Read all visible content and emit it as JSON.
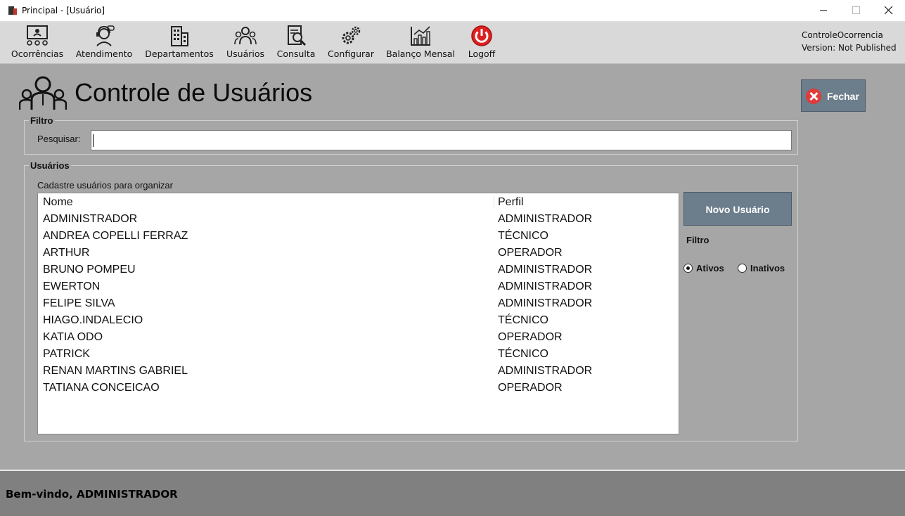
{
  "window": {
    "title": "Principal - [Usuário]"
  },
  "toolbar": {
    "items": [
      {
        "label": "Ocorrências",
        "icon": "dashboard-people-icon"
      },
      {
        "label": "Atendimento",
        "icon": "support-agent-icon"
      },
      {
        "label": "Departamentos",
        "icon": "building-icon"
      },
      {
        "label": "Usuários",
        "icon": "users-group-icon"
      },
      {
        "label": "Consulta",
        "icon": "document-search-icon"
      },
      {
        "label": "Configurar",
        "icon": "gears-icon"
      },
      {
        "label": "Balanço Mensal",
        "icon": "bar-chart-icon"
      },
      {
        "label": "Logoff",
        "icon": "power-icon"
      }
    ],
    "app_name": "ControleOcorrencia",
    "version": "Version: Not Published"
  },
  "page": {
    "title": "Controle de Usuários",
    "close_label": "Fechar"
  },
  "filter_group": {
    "title": "Filtro",
    "search_label": "Pesquisar:",
    "search_value": ""
  },
  "users_group": {
    "title": "Usuários",
    "hint": "Cadastre usuários para organizar",
    "columns": [
      "Nome",
      "Perfil"
    ],
    "rows": [
      {
        "nome": "ADMINISTRADOR",
        "perfil": "ADMINISTRADOR"
      },
      {
        "nome": "ANDREA COPELLI FERRAZ",
        "perfil": "TÉCNICO"
      },
      {
        "nome": "ARTHUR",
        "perfil": "OPERADOR"
      },
      {
        "nome": "BRUNO POMPEU",
        "perfil": "ADMINISTRADOR"
      },
      {
        "nome": "EWERTON",
        "perfil": "ADMINISTRADOR"
      },
      {
        "nome": "FELIPE SILVA",
        "perfil": "ADMINISTRADOR"
      },
      {
        "nome": "HIAGO.INDALECIO",
        "perfil": "TÉCNICO"
      },
      {
        "nome": "KATIA ODO",
        "perfil": "OPERADOR"
      },
      {
        "nome": "PATRICK",
        "perfil": "TÉCNICO"
      },
      {
        "nome": "RENAN MARTINS GABRIEL",
        "perfil": "ADMINISTRADOR"
      },
      {
        "nome": "TATIANA CONCEICAO",
        "perfil": "OPERADOR"
      }
    ],
    "new_user_label": "Novo Usuário",
    "filter_label": "Filtro",
    "radio_active": "Ativos",
    "radio_inactive": "Inativos",
    "selected_filter": "Ativos"
  },
  "footer": {
    "welcome": "Bem-vindo,",
    "user": "ADMINISTRADOR"
  },
  "colors": {
    "background": "#a6a6a6",
    "button": "#6c7d8c",
    "footer": "#808080",
    "logoff_red": "#e02020"
  }
}
